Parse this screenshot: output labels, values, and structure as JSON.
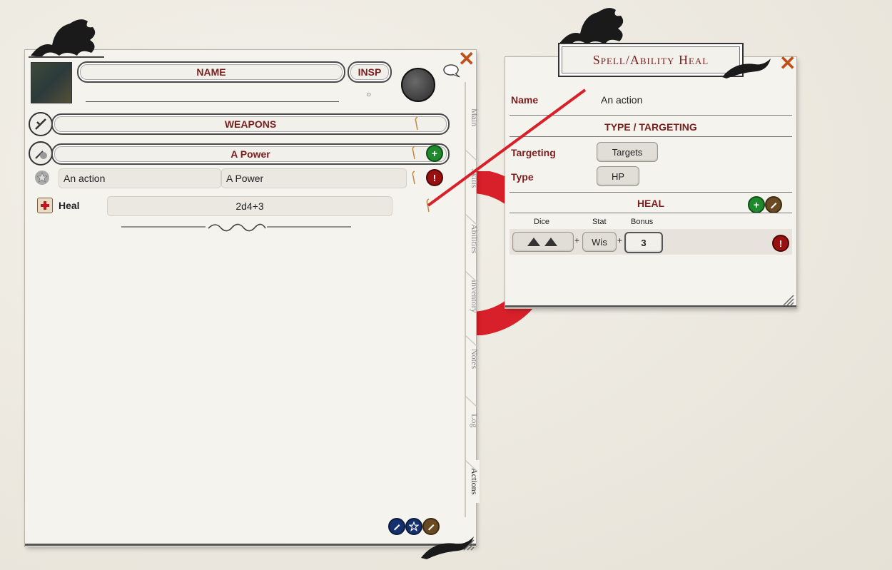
{
  "left_sheet": {
    "name_label": "NAME",
    "insp_label": "INSP",
    "insp_value": "○",
    "weapons_label": "WEAPONS",
    "power_label": "A Power",
    "action_row": {
      "name": "An action",
      "power": "A Power"
    },
    "heal_row": {
      "label": "Heal",
      "value": "2d4+3"
    },
    "tabs": [
      "Main",
      "Skills",
      "Abilities",
      "Inventory",
      "Notes",
      "Log",
      "Actions"
    ],
    "close_glyph": "✕"
  },
  "dialog": {
    "title": "Spell/Ability Heal",
    "name_label": "Name",
    "name_value": "An action",
    "type_targeting_header": "TYPE / TARGETING",
    "targeting_label": "Targeting",
    "targeting_value": "Targets",
    "type_label": "Type",
    "type_value": "HP",
    "heal_header": "HEAL",
    "dice_header": "Dice",
    "stat_header": "Stat",
    "bonus_header": "Bonus",
    "stat_value": "Wis",
    "bonus_value": "3",
    "plus": "+",
    "close_glyph": "✕"
  },
  "colors": {
    "accent_red": "#7a1e1e",
    "green_button": "#1f8a2d",
    "red_button": "#9a1010",
    "brown_button": "#6a4a22",
    "navy_button": "#14306e",
    "connector_red": "#d8202a"
  }
}
